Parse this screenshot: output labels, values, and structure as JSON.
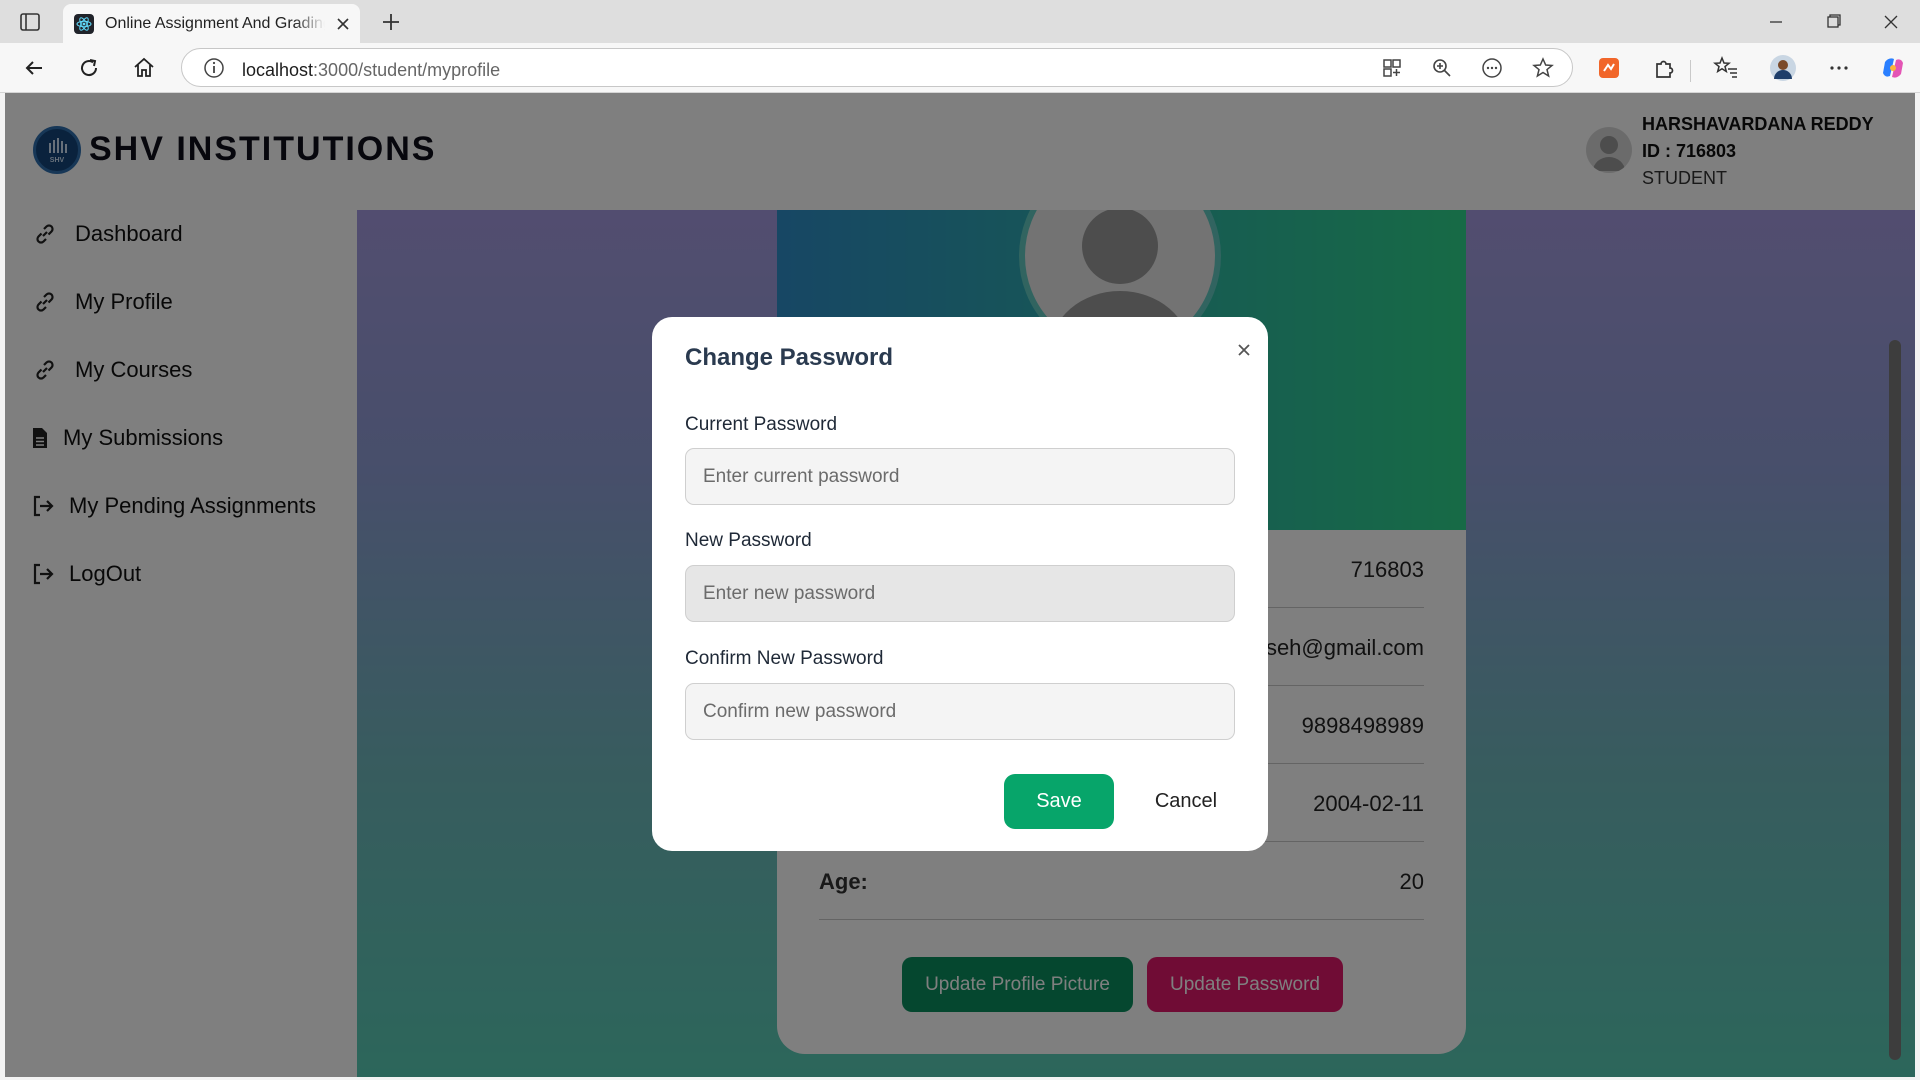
{
  "browser": {
    "tab_title": "Online Assignment And Grading System",
    "url_host": "localhost",
    "url_path": ":3000/student/myprofile"
  },
  "header": {
    "brand": "SHV INSTITUTIONS",
    "logo_text": "SHV",
    "user_name": "HARSHAVARDANA REDDY",
    "user_id": "ID : 716803",
    "user_role": "STUDENT"
  },
  "sidebar": {
    "items": [
      {
        "label": "Dashboard",
        "icon": "link-icon"
      },
      {
        "label": "My Profile",
        "icon": "link-icon"
      },
      {
        "label": "My Courses",
        "icon": "link-icon"
      },
      {
        "label": "My Submissions",
        "icon": "file-icon"
      },
      {
        "label": "My Pending Assignments",
        "icon": "sign-out-icon"
      },
      {
        "label": "LogOut",
        "icon": "sign-out-icon"
      }
    ]
  },
  "profile": {
    "rows": [
      {
        "key": "",
        "value": "716803"
      },
      {
        "key": "",
        "value": "seh@gmail.com"
      },
      {
        "key": "",
        "value": "9898498989"
      },
      {
        "key": "",
        "value": "2004-02-11"
      },
      {
        "key": "Age:",
        "value": "20"
      }
    ],
    "update_picture_label": "Update Profile Picture",
    "update_password_label": "Update Password"
  },
  "modal": {
    "title": "Change Password",
    "current_label": "Current Password",
    "current_placeholder": "Enter current password",
    "new_label": "New Password",
    "new_placeholder": "Enter new password",
    "confirm_label": "Confirm New Password",
    "confirm_placeholder": "Confirm new password",
    "save_label": "Save",
    "cancel_label": "Cancel"
  },
  "colors": {
    "save": "#07a56a",
    "update_picture": "#0b8f5e",
    "update_password": "#e0196b",
    "title": "#2a3a4f"
  }
}
